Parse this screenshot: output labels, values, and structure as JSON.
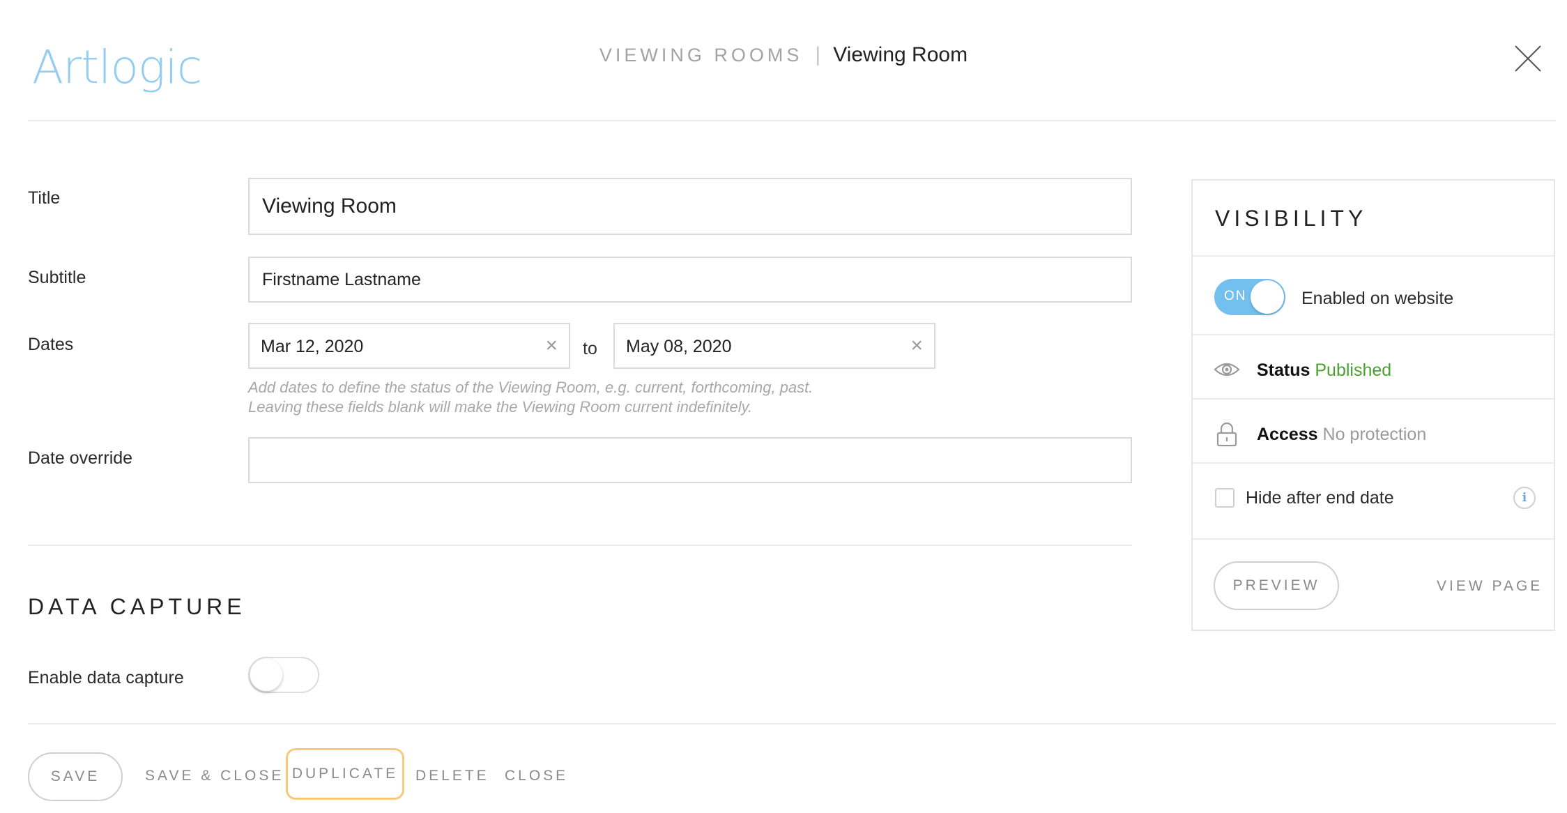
{
  "header": {
    "logo": "Artlogic",
    "breadcrumb_parent": "VIEWING ROOMS",
    "breadcrumb_separator": "|",
    "breadcrumb_current": "Viewing Room"
  },
  "form": {
    "title_label": "Title",
    "title_value": "Viewing Room",
    "subtitle_label": "Subtitle",
    "subtitle_value": "Firstname Lastname",
    "dates_label": "Dates",
    "start_date": "Mar 12, 2020",
    "to_label": "to",
    "end_date": "May 08, 2020",
    "clear_glyph": "×",
    "hint_line1": "Add dates to define the status of the Viewing Room, e.g. current, forthcoming, past.",
    "hint_line2": "Leaving these fields blank will make the Viewing Room current indefinitely.",
    "date_override_label": "Date override",
    "date_override_value": ""
  },
  "data_capture": {
    "section_title": "DATA CAPTURE",
    "enable_label": "Enable data capture",
    "enabled": false
  },
  "visibility": {
    "title": "VISIBILITY",
    "toggle_label": "ON",
    "enabled_text": "Enabled on website",
    "status_label": "Status",
    "status_value": "Published",
    "access_label": "Access",
    "access_value": "No protection",
    "hide_after_end_label": "Hide after end date",
    "info_glyph": "i",
    "preview_label": "PREVIEW",
    "view_page_label": "VIEW PAGE",
    "colors": {
      "toggle_on": "#73c0ef",
      "status_published": "#4aa12f"
    }
  },
  "footer": {
    "save_label": "SAVE",
    "save_close_label": "SAVE & CLOSE",
    "duplicate_label": "DUPLICATE",
    "delete_label": "DELETE",
    "close_label": "CLOSE",
    "colors": {
      "focus_outline": "#f7c97a"
    }
  },
  "icons": {
    "close": "close-icon",
    "eye": "eye-icon",
    "lock": "lock-icon",
    "info": "info-icon"
  }
}
